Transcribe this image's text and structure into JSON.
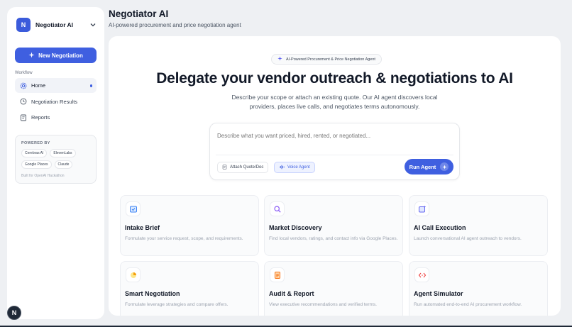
{
  "workspace": {
    "initial": "N",
    "name": "Negotiator AI"
  },
  "sidebar": {
    "new_button_label": "New Negotiation",
    "section_label": "Workflow",
    "items": [
      {
        "label": "Home",
        "icon": "gear-icon",
        "active": true
      },
      {
        "label": "Negotiation Results",
        "icon": "history-icon"
      },
      {
        "label": "Reports",
        "icon": "report-icon"
      }
    ],
    "powered_by": {
      "title": "POWERED BY",
      "chips": [
        "Cerebras AI",
        "ElevenLabs",
        "Google Places",
        "Claude"
      ],
      "note": "Built for OpenAI Hackathon"
    },
    "fab_label": "N"
  },
  "header": {
    "title": "Negotiator AI",
    "subtitle": "AI-powered procurement and price negotiation agent"
  },
  "main": {
    "badge": "AI-Powered Procurement & Price Negotiation Agent",
    "hero_title": "Delegate your vendor outreach & negotiations to AI",
    "hero_description": "Describe your scope or attach an existing quote. Our AI agent discovers local providers, places live calls, and negotiates terms autonomously.",
    "prompt": {
      "placeholder": "Describe what you want priced, hired, rented, or negotiated...",
      "attach_label": "Attach Quote/Doc",
      "voice_label": "Voice Agent",
      "run_label": "Run Agent"
    },
    "cards": [
      {
        "title": "Intake Brief",
        "description": "Formulate your service request, scope, and requirements.",
        "icon": "intake-icon",
        "accent": "#3b82f6"
      },
      {
        "title": "Market Discovery",
        "description": "Find local vendors, ratings, and contact info via Google Places.",
        "icon": "search-icon",
        "accent": "#8b5cf6"
      },
      {
        "title": "AI Call Execution",
        "description": "Launch conversational AI agent outreach to vendors.",
        "icon": "phone-ai-icon",
        "accent": "#6366f1"
      },
      {
        "title": "Smart Negotiation",
        "description": "Formulate leverage strategies and compare offers.",
        "icon": "pie-chart-icon",
        "accent": "#f59e0b"
      },
      {
        "title": "Audit & Report",
        "description": "View executive recommendations and verified terms.",
        "icon": "document-icon",
        "accent": "#f97316"
      },
      {
        "title": "Agent Simulator",
        "description": "Run automated end-to-end AI procurement workflow.",
        "icon": "code-icon",
        "accent": "#ef4444"
      }
    ]
  },
  "colors": {
    "accent": "#3f5fe0",
    "background": "#eef0f3"
  }
}
